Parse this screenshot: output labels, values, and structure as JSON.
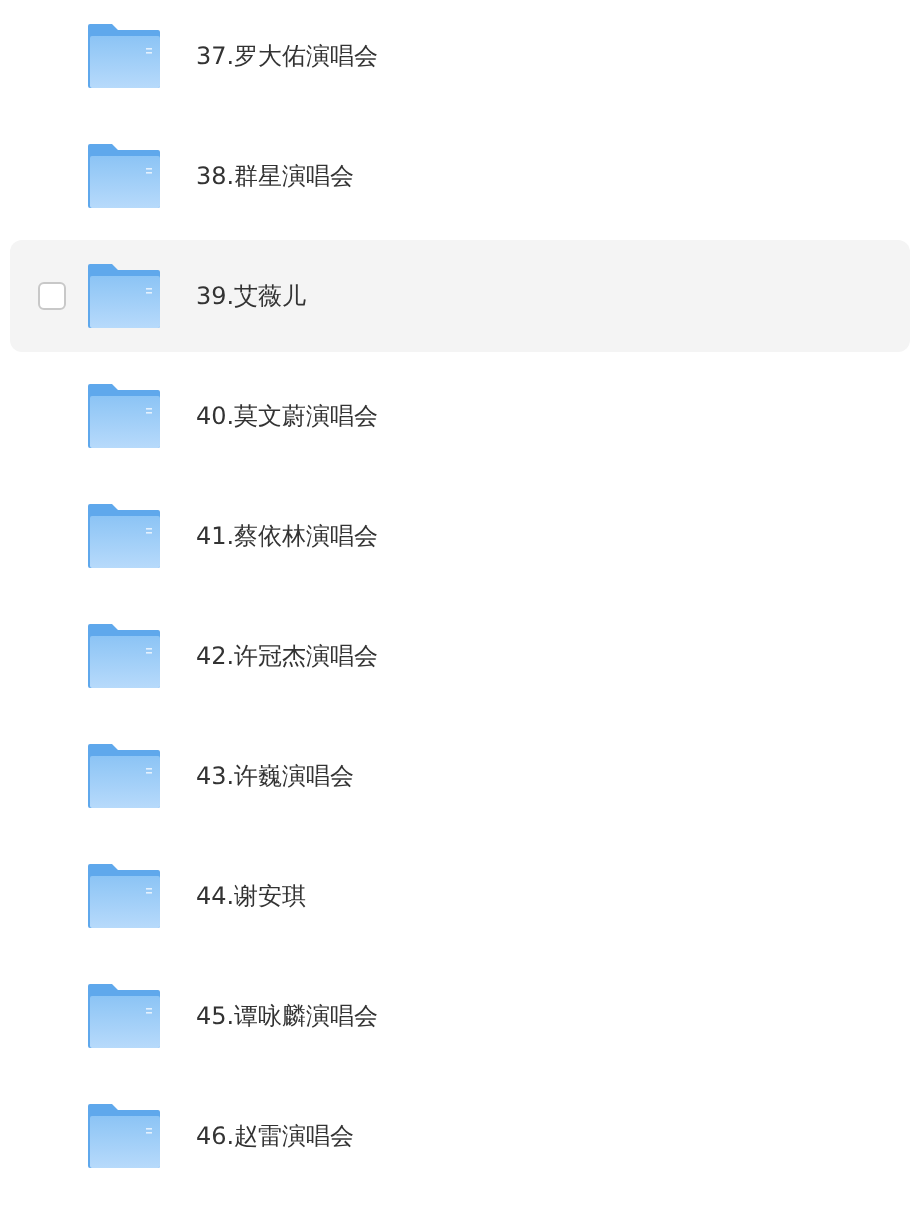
{
  "folders": [
    {
      "name": "37.罗大佑演唱会",
      "highlighted": false,
      "checked": false
    },
    {
      "name": "38.群星演唱会",
      "highlighted": false,
      "checked": false
    },
    {
      "name": "39.艾薇儿",
      "highlighted": true,
      "checked": false
    },
    {
      "name": "40.莫文蔚演唱会",
      "highlighted": false,
      "checked": false
    },
    {
      "name": "41.蔡依林演唱会",
      "highlighted": false,
      "checked": false
    },
    {
      "name": "42.许冠杰演唱会",
      "highlighted": false,
      "checked": false
    },
    {
      "name": "43.许巍演唱会",
      "highlighted": false,
      "checked": false
    },
    {
      "name": "44.谢安琪",
      "highlighted": false,
      "checked": false
    },
    {
      "name": "45.谭咏麟演唱会",
      "highlighted": false,
      "checked": false
    },
    {
      "name": "46.赵雷演唱会",
      "highlighted": false,
      "checked": false
    }
  ]
}
